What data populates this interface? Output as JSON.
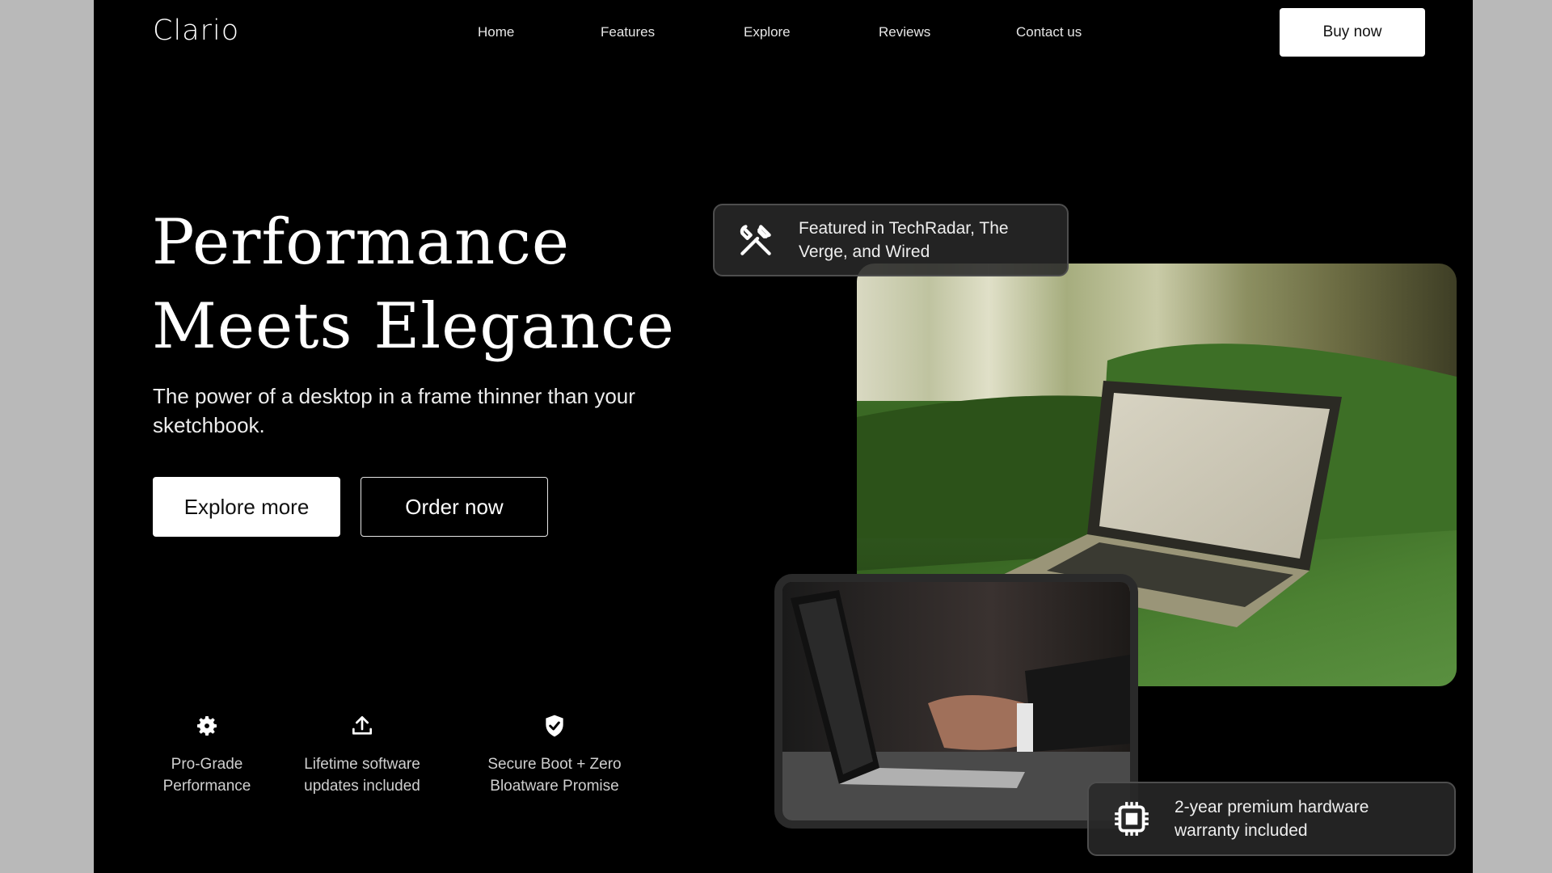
{
  "brand": {
    "logo": "Clario"
  },
  "nav": {
    "items": [
      {
        "label": "Home"
      },
      {
        "label": "Features"
      },
      {
        "label": "Explore"
      },
      {
        "label": "Reviews"
      },
      {
        "label": "Contact us"
      }
    ],
    "cta_label": "Buy now"
  },
  "hero": {
    "title_line1": "Performance",
    "title_line2": "Meets Elegance",
    "subtitle": "The power of a desktop in a frame thinner than your sketchbook.",
    "primary_button": "Explore more",
    "secondary_button": "Order now"
  },
  "features": [
    {
      "icon": "gear-icon",
      "line1": "Pro-Grade",
      "line2": "Performance"
    },
    {
      "icon": "upload-icon",
      "line1": "Lifetime software",
      "line2": "updates included"
    },
    {
      "icon": "shield-check-icon",
      "line1": "Secure Boot + Zero",
      "line2": "Bloatware Promise"
    }
  ],
  "badges": {
    "press": {
      "icon": "tools-icon",
      "line1": "Featured in TechRadar, The",
      "line2": "Verge, and Wired"
    },
    "warranty": {
      "icon": "chip-icon",
      "line1": "2-year premium hardware",
      "line2": "warranty included"
    }
  },
  "colors": {
    "background": "#000000",
    "accent_green": "#3f6b2a",
    "button_bg": "#ffffff"
  }
}
